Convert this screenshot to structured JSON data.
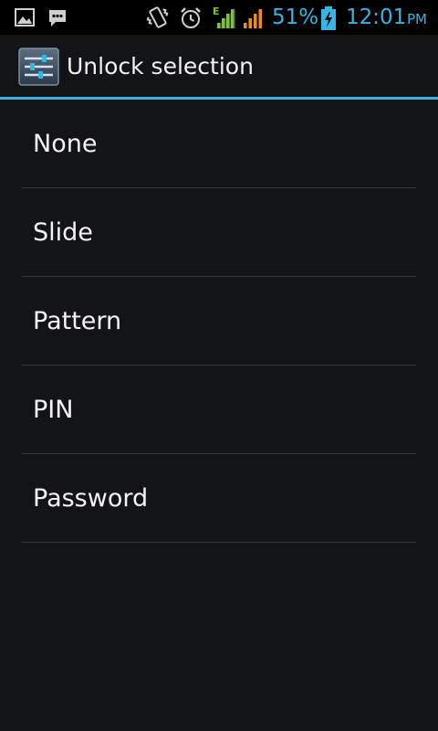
{
  "status_bar": {
    "left_icons": [
      "picture-icon",
      "chat-message-icon"
    ],
    "right_icons": [
      "vibrate-icon",
      "alarm-clock-icon",
      "edge-signal-icon",
      "signal-strength-icon",
      "battery-charging-icon"
    ],
    "network_type": "E",
    "battery_percent": "51%",
    "time": "12:01",
    "time_period": "PM",
    "colors": {
      "accent": "#33b5e5",
      "signal_green": "#7ec13b",
      "signal_orange": "#f28a1a"
    }
  },
  "action_bar": {
    "icon": "settings-sliders-icon",
    "title": "Unlock selection",
    "accent_color": "#33b5e5"
  },
  "unlock_options": [
    {
      "label": "None"
    },
    {
      "label": "Slide"
    },
    {
      "label": "Pattern"
    },
    {
      "label": "PIN"
    },
    {
      "label": "Password"
    }
  ]
}
